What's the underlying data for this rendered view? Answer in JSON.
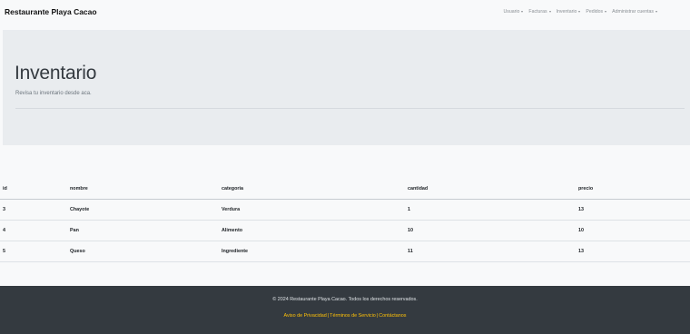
{
  "navbar": {
    "brand": "Restaurante Playa Cacao",
    "menu": [
      {
        "label": "Usuario"
      },
      {
        "label": "Facturas"
      },
      {
        "label": "Inventario"
      },
      {
        "label": "Pedidos"
      },
      {
        "label": "Administrar cuentas"
      }
    ]
  },
  "jumbotron": {
    "title": "Inventario",
    "lead": "Revisa tu inventario desde aca."
  },
  "table": {
    "headers": [
      "id",
      "nombre",
      "categoria",
      "cantidad",
      "precio"
    ],
    "rows": [
      [
        "3",
        "Chayote",
        "Verdura",
        "1",
        "13"
      ],
      [
        "4",
        "Pan",
        "Alimento",
        "10",
        "10"
      ],
      [
        "5",
        "Queso",
        "Ingrediente",
        "11",
        "13"
      ]
    ]
  },
  "footer": {
    "copyright": "© 2024 Restaurante Playa Cacao. Todos los derechos reservados.",
    "links": {
      "privacy": "Aviso de Privacidad",
      "terms": "Términos de Servicio",
      "contact": "Contáctanos",
      "separator": "|"
    }
  }
}
